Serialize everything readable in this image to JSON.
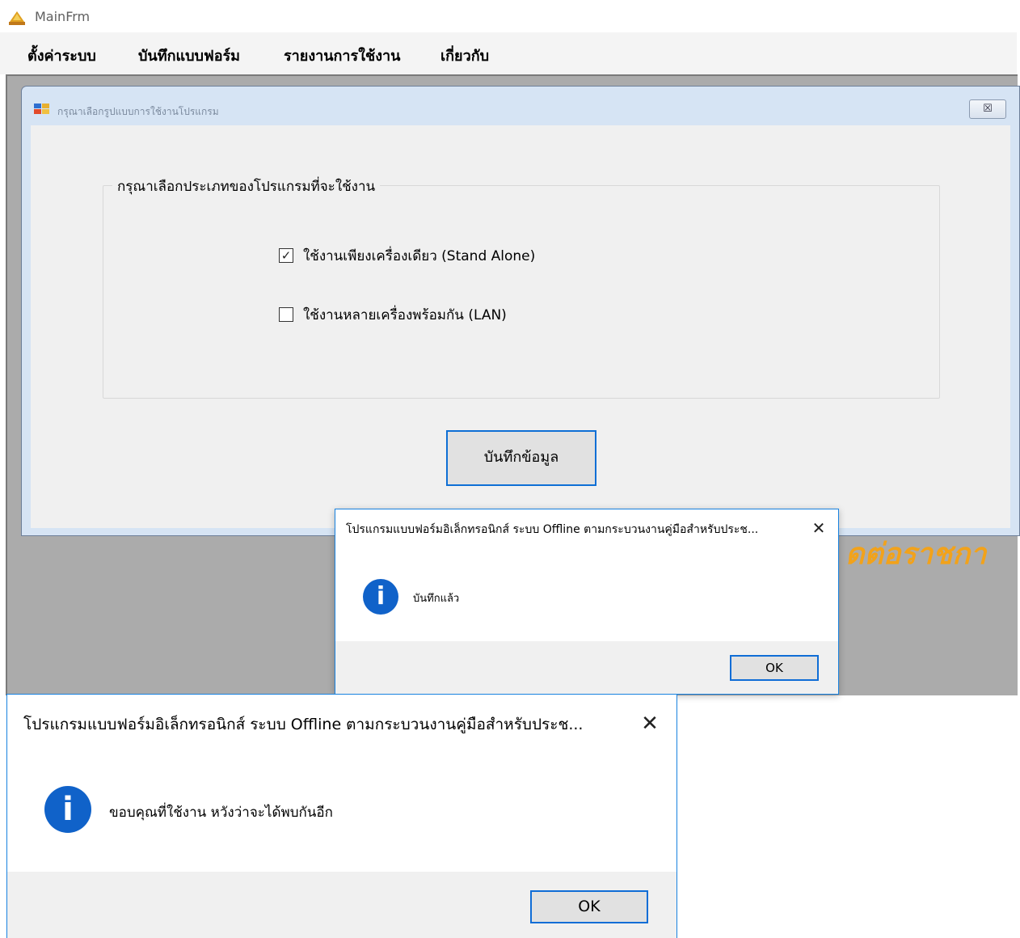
{
  "main_window": {
    "title": "MainFrm",
    "menu": [
      "ตั้งค่าระบบ",
      "บันทึกแบบฟอร์ม",
      "รายงานการใช้งาน",
      "เกี่ยวกับ"
    ]
  },
  "setup_form": {
    "title": "กรุณาเลือกรูปแบบการใช้งานโปรแกรม",
    "close_glyph": "☒",
    "group_label": "กรุณาเลือกประเภทของโปรแกรมที่จะใช้งาน",
    "options": [
      {
        "label": "ใช้งานเพียงเครื่องเดียว (Stand Alone)",
        "checked": true,
        "mark": "✓"
      },
      {
        "label": "ใช้งานหลายเครื่องพร้อมกัน (LAN)",
        "checked": false,
        "mark": ""
      }
    ],
    "save_label": "บันทึกข้อมูล"
  },
  "background_text": "ดต่อราชกา",
  "dialog_saved": {
    "title": "โปรแกรมแบบฟอร์มอิเล็กทรอนิกส์ ระบบ Offline ตามกระบวนงานคู่มือสำหรับประช...",
    "close_glyph": "✕",
    "icon_glyph": "i",
    "message": "บันทึกแล้ว",
    "ok_label": "OK"
  },
  "dialog_thanks": {
    "title": "โปรแกรมแบบฟอร์มอิเล็กทรอนิกส์ ระบบ Offline ตามกระบวนงานคู่มือสำหรับประช...",
    "close_glyph": "✕",
    "icon_glyph": "i",
    "message": "ขอบคุณที่ใช้งาน หวังว่าจะได้พบกันอีก",
    "ok_label": "OK"
  },
  "colors": {
    "accent_blue": "#0f6dd6",
    "info_icon": "#1062c9",
    "form_frame": "#d6e4f4",
    "mdi_background": "#ababab",
    "orange_text": "#f2a21a"
  }
}
